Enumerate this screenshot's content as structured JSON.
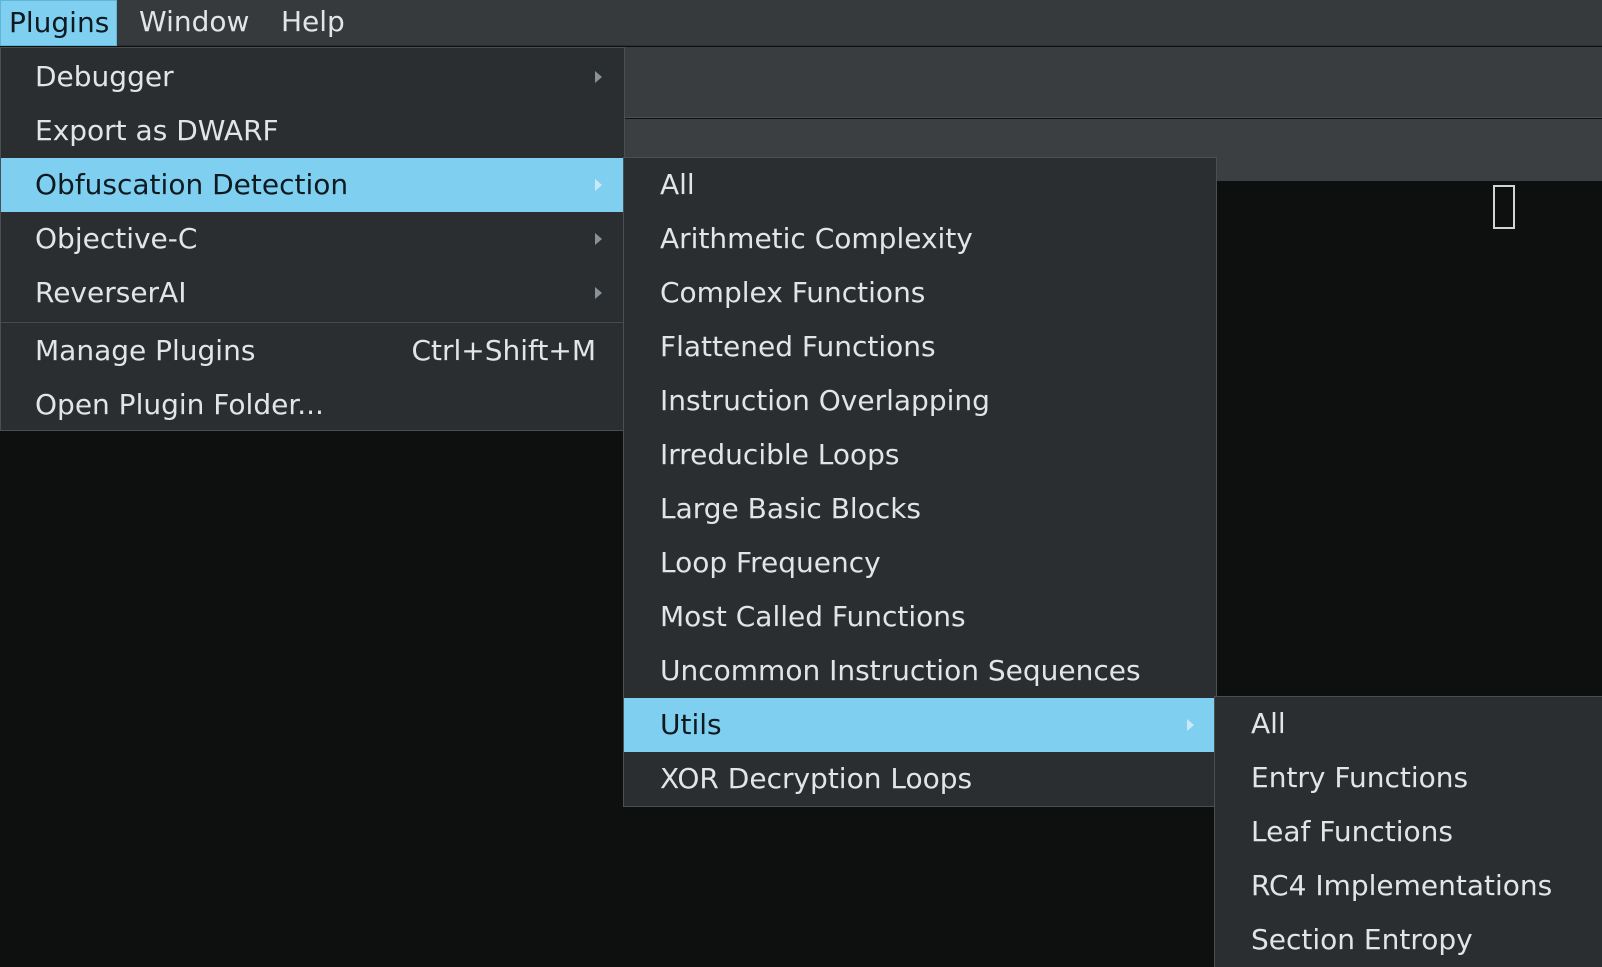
{
  "menubar": {
    "items": [
      {
        "label": "Plugins",
        "active": true
      },
      {
        "label": "Window",
        "active": false
      },
      {
        "label": "Help",
        "active": false
      }
    ]
  },
  "plugins_menu": {
    "items": [
      {
        "label": "Debugger",
        "submenu": true
      },
      {
        "label": "Export as DWARF",
        "submenu": false
      },
      {
        "label": "Obfuscation Detection",
        "submenu": true,
        "highlighted": true
      },
      {
        "label": "Objective-C",
        "submenu": true
      },
      {
        "label": "ReverserAI",
        "submenu": true
      },
      {
        "label": "Manage Plugins",
        "shortcut": "Ctrl+Shift+M"
      },
      {
        "label": "Open Plugin Folder..."
      }
    ]
  },
  "obfuscation_menu": {
    "items": [
      {
        "label": "All"
      },
      {
        "label": "Arithmetic Complexity"
      },
      {
        "label": "Complex Functions"
      },
      {
        "label": "Flattened Functions"
      },
      {
        "label": "Instruction Overlapping"
      },
      {
        "label": "Irreducible Loops"
      },
      {
        "label": "Large Basic Blocks"
      },
      {
        "label": "Loop Frequency"
      },
      {
        "label": "Most Called Functions"
      },
      {
        "label": "Uncommon Instruction Sequences"
      },
      {
        "label": "Utils",
        "submenu": true,
        "highlighted": true
      },
      {
        "label": "XOR Decryption Loops"
      }
    ]
  },
  "utils_menu": {
    "items": [
      {
        "label": "All"
      },
      {
        "label": "Entry Functions"
      },
      {
        "label": "Leaf Functions"
      },
      {
        "label": "RC4 Implementations"
      },
      {
        "label": "Section Entropy"
      }
    ]
  },
  "colors": {
    "highlight": "#7fd0f0",
    "menu_bg": "#2b2e31",
    "background": "#0e1010"
  }
}
